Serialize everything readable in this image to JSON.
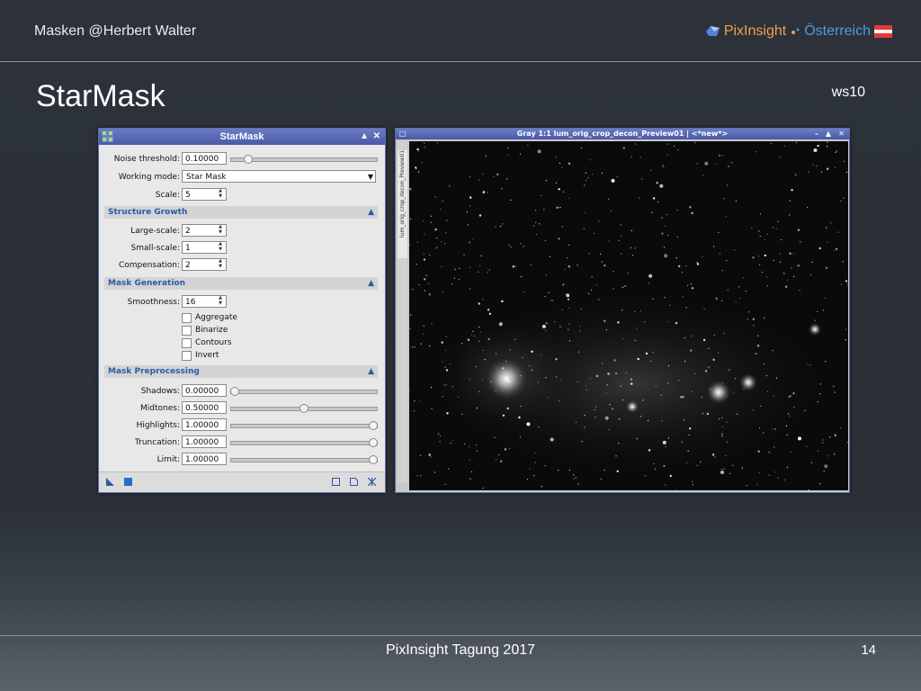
{
  "slide": {
    "header_left": "Masken  @Herbert Walter",
    "brand_pixinsight": "PixInsight",
    "brand_country": "Österreich",
    "title": "StarMask",
    "ws_id": "ws10",
    "footer": "PixInsight Tagung 2017",
    "page_number": "14"
  },
  "dialog": {
    "title": "StarMask",
    "noise_threshold": {
      "label": "Noise threshold:",
      "value": "0.10000",
      "slider_fraction": 0.1
    },
    "working_mode": {
      "label": "Working mode:",
      "value": "Star Mask"
    },
    "scale": {
      "label": "Scale:",
      "value": "5"
    },
    "structure_growth": {
      "header": "Structure Growth",
      "large_scale": {
        "label": "Large-scale:",
        "value": "2"
      },
      "small_scale": {
        "label": "Small-scale:",
        "value": "1"
      },
      "compensation": {
        "label": "Compensation:",
        "value": "2"
      }
    },
    "mask_generation": {
      "header": "Mask Generation",
      "smoothness": {
        "label": "Smoothness:",
        "value": "16"
      },
      "aggregate": "Aggregate",
      "binarize": "Binarize",
      "contours": "Contours",
      "invert": "Invert"
    },
    "mask_preprocessing": {
      "header": "Mask Preprocessing",
      "shadows": {
        "label": "Shadows:",
        "value": "0.00000",
        "slider_fraction": 0.0
      },
      "midtones": {
        "label": "Midtones:",
        "value": "0.50000",
        "slider_fraction": 0.5
      },
      "highlights": {
        "label": "Highlights:",
        "value": "1.00000",
        "slider_fraction": 1.0
      },
      "truncation": {
        "label": "Truncation:",
        "value": "1.00000",
        "slider_fraction": 1.0
      },
      "limit": {
        "label": "Limit:",
        "value": "1.00000",
        "slider_fraction": 1.0
      }
    }
  },
  "image_window": {
    "title": "Gray 1:1 lum_orig_crop_decon_Preview01 | <*new*>",
    "side_tab": "lum_orig_crop_decon_Preview01"
  },
  "colors": {
    "accent_blue": "#4e9be0",
    "accent_orange": "#f0a04b",
    "section_text": "#2a5aa8",
    "titlebar": "#5566b4"
  }
}
